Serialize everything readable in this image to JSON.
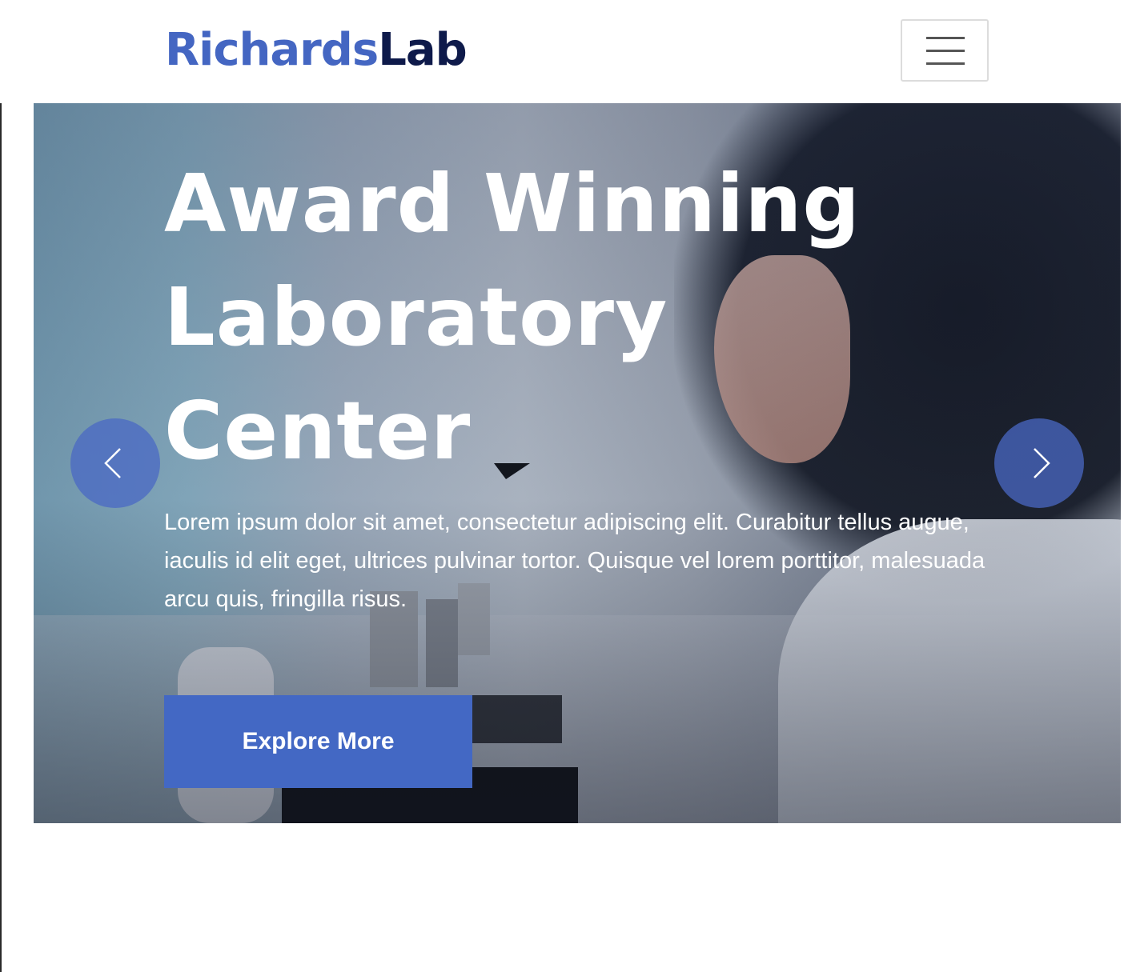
{
  "brand": {
    "part1": "Richards",
    "part2": "Lab"
  },
  "navbar": {
    "menu_icon": "hamburger-menu-icon"
  },
  "hero": {
    "title": "Award Winning\nLaboratory\nCenter",
    "text": "Lorem ipsum dolor sit amet, consectetur adipiscing elit. Curabitur tellus augue, iaculis id elit eget, ultrices pulvinar tortor. Quisque vel lorem porttitor, malesuada arcu quis, fringilla risus.",
    "button_label": "Explore More",
    "image": "scientist-with-microscope",
    "prev_icon": "chevron-left-icon",
    "next_icon": "chevron-right-icon"
  },
  "colors": {
    "brand_primary": "#4466c2",
    "brand_dark": "#0e1a4a",
    "button": "#4368c4"
  }
}
